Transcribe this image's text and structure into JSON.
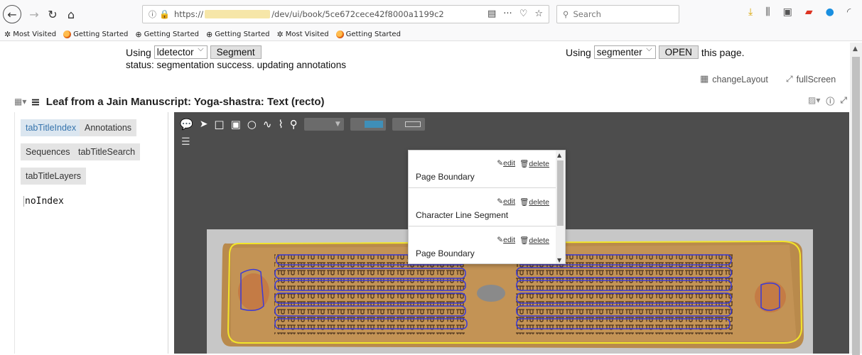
{
  "browser": {
    "url_prefix": "https://",
    "url_suffix": "/dev/ui/book/5ce672cece42f8000a1199c2",
    "search_placeholder": "Search",
    "bookmarks": [
      {
        "label": "Most Visited",
        "icon": "gear-icon"
      },
      {
        "label": "Getting Started",
        "icon": "firefox-icon"
      },
      {
        "label": "Getting Started",
        "icon": "globe-icon"
      },
      {
        "label": "Getting Started",
        "icon": "globe-icon"
      },
      {
        "label": "Most Visited",
        "icon": "gear-icon"
      },
      {
        "label": "Getting Started",
        "icon": "firefox-icon"
      }
    ]
  },
  "segmentation": {
    "left_using": "Using",
    "left_select": "ldetector",
    "segment_button": "Segment",
    "status": "status: segmentation success. updating annotations",
    "right_using": "Using",
    "right_select": "segmenter",
    "open_button": "OPEN",
    "this_page": "this page."
  },
  "layout": {
    "change_layout": "changeLayout",
    "fullscreen": "fullScreen"
  },
  "title": "Leaf from a Jain Manuscript: Yoga-shastra: Text (recto)",
  "tabs": [
    {
      "label": "tabTitleIndex",
      "active": true
    },
    {
      "label": "Annotations",
      "active": false
    },
    {
      "label": "Sequences",
      "active": false
    },
    {
      "label": "tabTitleSearch",
      "active": false
    },
    {
      "label": "tabTitleLayers",
      "active": false
    }
  ],
  "no_index": "noIndex",
  "annotations_popup": {
    "edit_label": "edit",
    "delete_label": "delete",
    "items": [
      {
        "label": "Page Boundary"
      },
      {
        "label": "Character Line Segment"
      },
      {
        "label": "Page Boundary"
      }
    ]
  },
  "colors": {
    "viewer_bg": "#4d4d4d",
    "tab_active_text": "#3674ad",
    "annotation_line": "#3a3ad8",
    "page_boundary": "#f2e52a"
  }
}
